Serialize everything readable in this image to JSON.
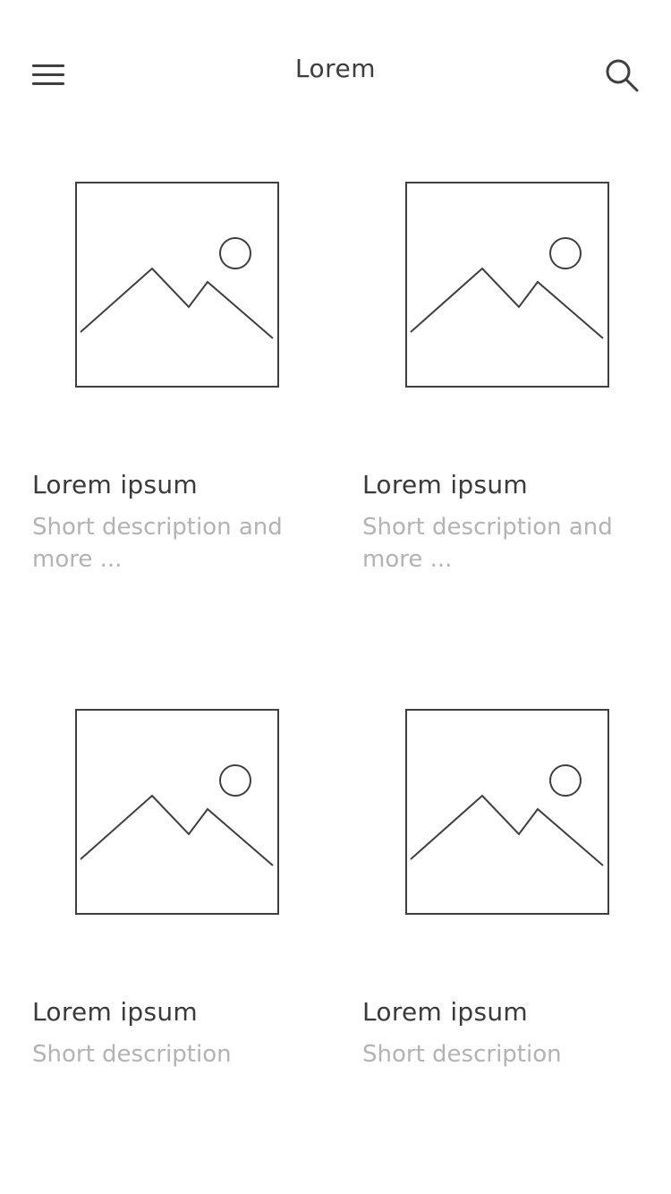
{
  "header": {
    "title": "Lorem",
    "menu_icon": "hamburger-menu-icon",
    "search_icon": "search-icon"
  },
  "colors": {
    "text": "#3a3a3a",
    "muted": "#b3b3b3",
    "stroke": "#3f3f3f",
    "background": "#ffffff"
  },
  "cards": [
    {
      "title": "Lorem ipsum",
      "description": "Short description and more ...",
      "image_icon": "image-placeholder-icon"
    },
    {
      "title": "Lorem ipsum",
      "description": "Short description and more ...",
      "image_icon": "image-placeholder-icon"
    },
    {
      "title": "Lorem ipsum",
      "description": "Short description",
      "image_icon": "image-placeholder-icon"
    },
    {
      "title": "Lorem ipsum",
      "description": "Short description",
      "image_icon": "image-placeholder-icon"
    }
  ]
}
